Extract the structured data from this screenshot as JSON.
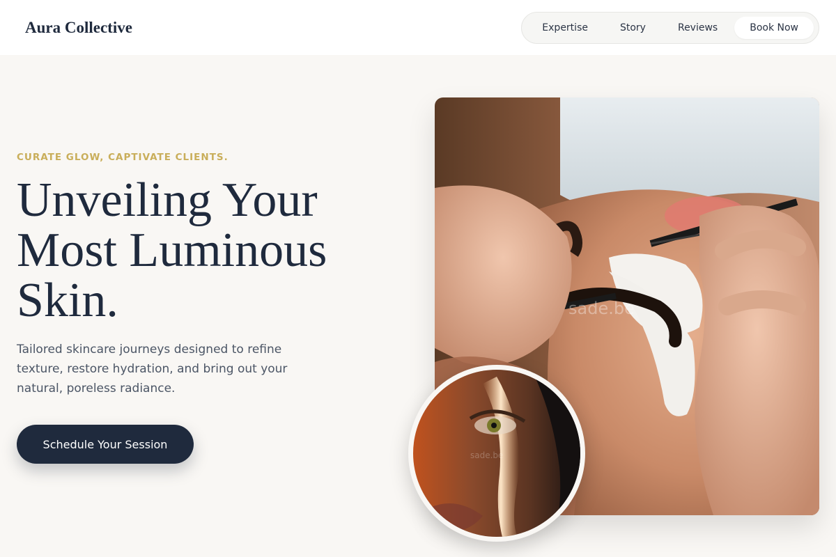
{
  "header": {
    "brand": "Aura Collective",
    "nav": [
      {
        "label": "Expertise"
      },
      {
        "label": "Story"
      },
      {
        "label": "Reviews"
      },
      {
        "label": "Book Now"
      }
    ]
  },
  "hero": {
    "eyebrow": "CURATE GLOW, CAPTIVATE CLIENTS.",
    "headline_lines": [
      "Unveiling Your",
      "Most Luminous",
      "Skin."
    ],
    "description": "Tailored skincare journeys designed to refine texture, restore hydration, and bring out your natural, poreless radiance.",
    "cta_label": "Schedule Your Session"
  },
  "images": {
    "main_watermark": "sade.be",
    "round_watermark": "sade.be"
  },
  "colors": {
    "background": "#f9f7f4",
    "navy": "#1f2a3d",
    "gold": "#c9ae5a",
    "body_text": "#4b5565"
  }
}
